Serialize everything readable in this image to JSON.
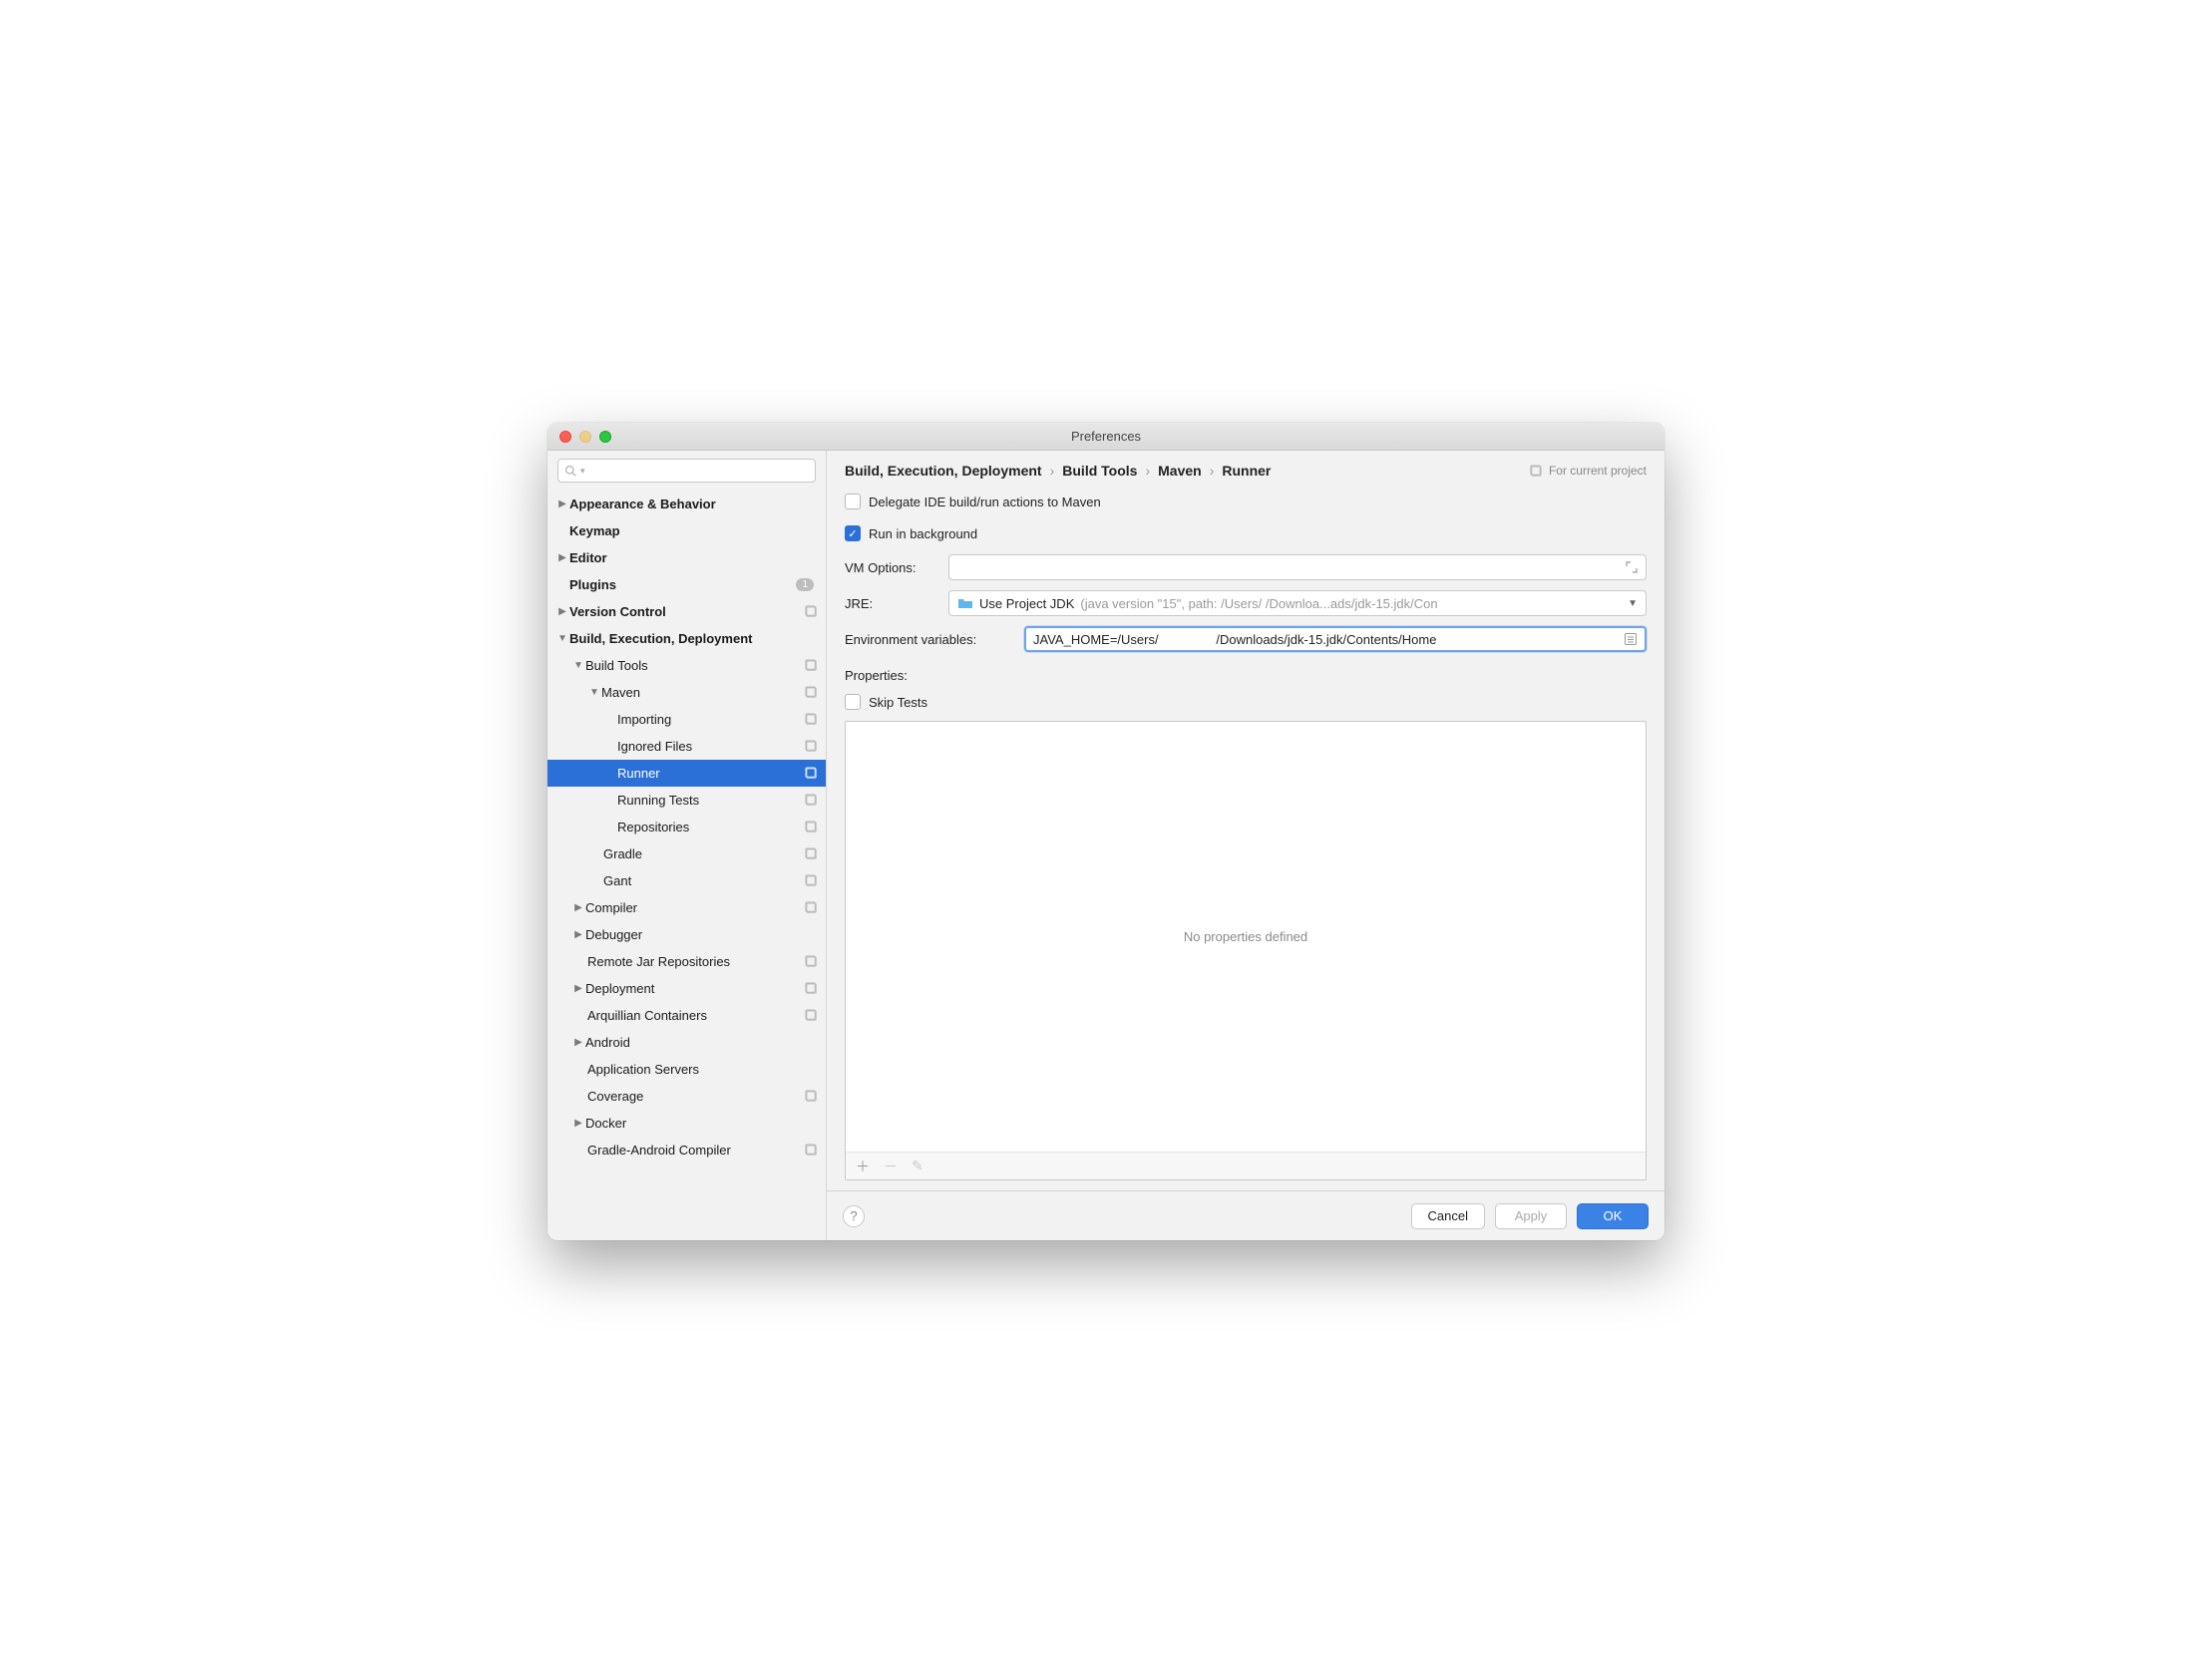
{
  "window_title": "Preferences",
  "search_placeholder": "",
  "tree": {
    "appearance": "Appearance & Behavior",
    "keymap": "Keymap",
    "editor": "Editor",
    "plugins": "Plugins",
    "plugins_badge": "1",
    "vc": "Version Control",
    "bed": "Build, Execution, Deployment",
    "build_tools": "Build Tools",
    "maven": "Maven",
    "importing": "Importing",
    "ignored": "Ignored Files",
    "runner": "Runner",
    "running_tests": "Running Tests",
    "repositories": "Repositories",
    "gradle": "Gradle",
    "gant": "Gant",
    "compiler": "Compiler",
    "debugger": "Debugger",
    "remote_jar": "Remote Jar Repositories",
    "deployment": "Deployment",
    "arquillian": "Arquillian Containers",
    "android": "Android",
    "app_servers": "Application Servers",
    "coverage": "Coverage",
    "docker": "Docker",
    "gradle_android": "Gradle-Android Compiler"
  },
  "breadcrumb": {
    "a": "Build, Execution, Deployment",
    "b": "Build Tools",
    "c": "Maven",
    "d": "Runner"
  },
  "for_project": "For current project",
  "form": {
    "delegate": "Delegate IDE build/run actions to Maven",
    "run_bg": "Run in background",
    "vm_label": "VM Options:",
    "jre_label": "JRE:",
    "jre_prefix": "Use Project JDK",
    "jre_hint": "(java version \"15\", path: /Users/               /Downloa...ads/jdk-15.jdk/Con",
    "env_label": "Environment variables:",
    "env_value": "JAVA_HOME=/Users/                /Downloads/jdk-15.jdk/Contents/Home",
    "props_label": "Properties:",
    "skip_tests": "Skip Tests",
    "no_props": "No properties defined"
  },
  "buttons": {
    "cancel": "Cancel",
    "apply": "Apply",
    "ok": "OK"
  }
}
